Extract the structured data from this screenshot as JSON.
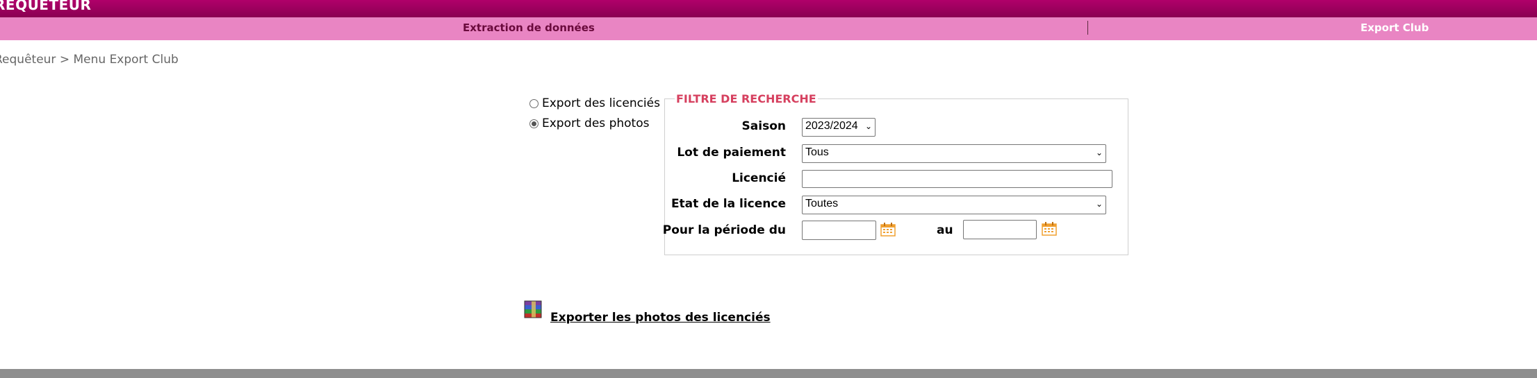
{
  "app": {
    "title": "REQUETEUR"
  },
  "menu": {
    "items": [
      {
        "label": "Extraction de données"
      },
      {
        "label": "Export Club"
      }
    ]
  },
  "breadcrumb": {
    "parent": "Requêteur",
    "separator": ">",
    "current": "Menu Export Club"
  },
  "export_options": [
    {
      "label": "Export des licenciés",
      "selected": false
    },
    {
      "label": "Export des photos",
      "selected": true
    }
  ],
  "filter": {
    "legend": "FILTRE DE RECHERCHE",
    "saison": {
      "label": "Saison",
      "value": "2023/2024"
    },
    "lot_paiement": {
      "label": "Lot de paiement",
      "value": "Tous"
    },
    "licencie": {
      "label": "Licencié",
      "value": ""
    },
    "etat_licence": {
      "label": "Etat de la licence",
      "value": "Toutes"
    },
    "periode": {
      "label": "Pour la période du",
      "from_value": "",
      "to_label": "au",
      "to_value": ""
    }
  },
  "export_action": {
    "label": "Exporter les photos des licenciés "
  },
  "colors": {
    "header": "#9a005c",
    "menubar": "#e985c3",
    "legend": "#d6405f"
  },
  "icons": {
    "calendar": "calendar-icon",
    "archive": "winrar-archive-icon",
    "chevron": "chevron-down-icon"
  }
}
